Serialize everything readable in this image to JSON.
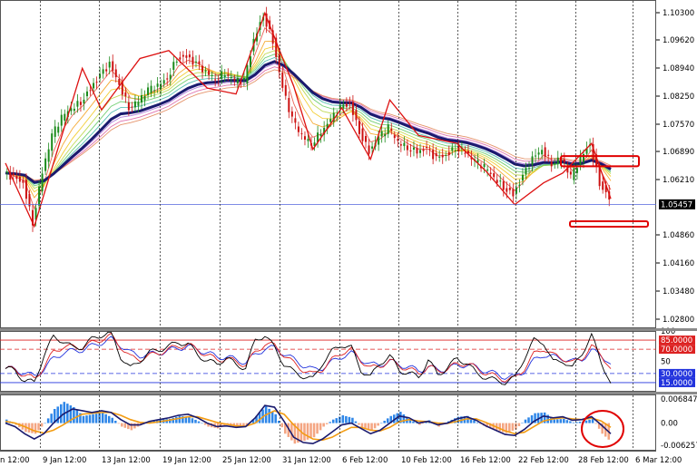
{
  "chart_data": {
    "type": "line",
    "x_labels": [
      "9 Jan 12:00",
      "13 Jan 12:00",
      "19 Jan 12:00",
      "25 Jan 12:00",
      "31 Jan 12:00",
      "6 Feb 12:00",
      "10 Feb 12:00",
      "16 Feb 12:00",
      "22 Feb 12:00",
      "28 Feb 12:00",
      "6 Mar 12:00"
    ],
    "x_label_first_partial": "n 12:00",
    "main": {
      "y_ticks": [
        "1.10300",
        "1.09620",
        "1.08940",
        "1.08250",
        "1.07570",
        "1.06890",
        "1.06210",
        "1.04860",
        "1.04160",
        "1.03480",
        "1.02800"
      ],
      "ylim": [
        1.0232,
        1.1063
      ],
      "current_price": "1.05457",
      "colors": {
        "candle_up": "#1a8a1a",
        "candle_down": "#cc1111",
        "zigzag": "#dd1111",
        "trend_ma": "#1a1a6e",
        "price_line": "#5566dd"
      },
      "close": [
        1.0625,
        1.0612,
        1.06,
        1.05,
        1.0628,
        1.072,
        1.0765,
        1.079,
        1.0805,
        1.0838,
        1.087,
        1.09,
        1.085,
        1.0792,
        1.0808,
        1.0835,
        1.0845,
        1.0865,
        1.0915,
        1.0918,
        1.09,
        1.088,
        1.0865,
        1.088,
        1.086,
        1.0858,
        1.096,
        1.1025,
        1.096,
        1.084,
        1.076,
        1.072,
        1.07,
        1.073,
        1.076,
        1.079,
        1.08,
        1.073,
        1.068,
        1.0715,
        1.074,
        1.0705,
        1.069,
        1.068,
        1.0685,
        1.066,
        1.067,
        1.069,
        1.068,
        1.0655,
        1.064,
        1.0615,
        1.059,
        1.057,
        1.0615,
        1.066,
        1.0685,
        1.065,
        1.0665,
        1.0615,
        1.066,
        1.07,
        1.06,
        1.056
      ],
      "zigzag": [
        [
          0,
          1.065
        ],
        [
          3,
          1.049
        ],
        [
          8,
          1.089
        ],
        [
          10,
          1.0785
        ],
        [
          14,
          1.0915
        ],
        [
          17,
          1.0935
        ],
        [
          21,
          1.084
        ],
        [
          24,
          1.0825
        ],
        [
          27,
          1.103
        ],
        [
          30,
          1.0845
        ],
        [
          32,
          1.0685
        ],
        [
          35,
          1.079
        ],
        [
          38,
          1.066
        ],
        [
          40,
          1.081
        ],
        [
          43,
          1.072
        ],
        [
          47,
          1.07
        ],
        [
          50,
          1.063
        ],
        [
          53,
          1.0545
        ],
        [
          56,
          1.06
        ],
        [
          58,
          1.0625
        ],
        [
          61,
          1.07
        ],
        [
          63,
          1.056
        ]
      ],
      "highlight_zones": [
        [
          1.0642,
          1.0668
        ],
        [
          1.0489,
          1.0503
        ]
      ]
    },
    "oscillator": {
      "y_ticks": [
        "100",
        "85.0000",
        "70.0000",
        "50",
        "30.0000",
        "15.0000"
      ],
      "levels": [
        85,
        70,
        30,
        15
      ],
      "ylim": [
        0,
        100
      ],
      "colors": {
        "line_black": "#000000",
        "line_red": "#dd2222",
        "line_blue": "#2233dd"
      },
      "values": [
        38,
        35,
        18,
        15,
        60,
        90,
        84,
        72,
        74,
        86,
        94,
        96,
        58,
        38,
        52,
        64,
        70,
        74,
        82,
        78,
        62,
        50,
        46,
        56,
        44,
        40,
        84,
        94,
        72,
        46,
        32,
        26,
        20,
        48,
        66,
        78,
        72,
        36,
        24,
        48,
        58,
        36,
        30,
        24,
        52,
        28,
        40,
        54,
        48,
        30,
        24,
        18,
        16,
        22,
        56,
        84,
        82,
        48,
        52,
        38,
        64,
        92,
        50,
        14
      ]
    },
    "macd": {
      "y_ticks": [
        "0.0068477",
        "0.00",
        "-0.006257"
      ],
      "ylim": [
        -0.0078,
        0.0081
      ],
      "colors": {
        "hist_pos": "#2e86e8",
        "hist_neg": "#f4a582",
        "line_dark": "#1a1a6e",
        "line_orange": "#f39c12"
      },
      "hist": [
        0.001,
        -0.0005,
        -0.0025,
        -0.003,
        0.0,
        0.004,
        0.006,
        0.0045,
        0.002,
        0.0025,
        0.003,
        0.0015,
        -0.001,
        -0.002,
        -0.0005,
        0.0005,
        0.001,
        0.0012,
        0.002,
        0.0018,
        0.0005,
        -0.001,
        -0.0015,
        -0.0005,
        -0.001,
        -0.0008,
        0.002,
        0.0048,
        0.0025,
        -0.003,
        -0.0058,
        -0.005,
        -0.004,
        -0.001,
        0.001,
        0.0022,
        0.0015,
        -0.0015,
        -0.0022,
        0.0,
        0.002,
        0.0032,
        0.001,
        -0.0005,
        0.0008,
        -0.001,
        0.0005,
        0.0018,
        0.002,
        0.0002,
        -0.0012,
        -0.002,
        -0.0028,
        -0.0018,
        0.001,
        0.0028,
        0.003,
        0.001,
        0.0012,
        0.0002,
        0.0005,
        0.0012,
        -0.003,
        -0.0055
      ],
      "macd_line": [
        0.0,
        -0.001,
        -0.003,
        -0.0045,
        -0.003,
        0.0,
        0.0025,
        0.004,
        0.0035,
        0.003,
        0.0035,
        0.003,
        0.001,
        -0.0005,
        -0.0005,
        0.0005,
        0.001,
        0.0015,
        0.0022,
        0.0025,
        0.0015,
        0.0,
        -0.001,
        -0.0008,
        -0.0012,
        -0.001,
        0.0015,
        0.005,
        0.0045,
        0.0005,
        -0.004,
        -0.0055,
        -0.0058,
        -0.0045,
        -0.0025,
        -0.0005,
        0.0,
        -0.0015,
        -0.003,
        -0.002,
        0.0,
        0.002,
        0.0015,
        0.0,
        0.0005,
        -0.0005,
        0.0,
        0.0012,
        0.0018,
        0.0008,
        -0.0008,
        -0.002,
        -0.0032,
        -0.0035,
        -0.0018,
        0.0005,
        0.002,
        0.0015,
        0.0018,
        0.0008,
        0.001,
        0.0018,
        -0.0005,
        -0.003
      ],
      "signal_line": [
        0.0005,
        0.0,
        -0.001,
        -0.0022,
        -0.0028,
        -0.002,
        -0.0005,
        0.0012,
        0.0025,
        0.0028,
        0.003,
        0.003,
        0.0022,
        0.001,
        0.0002,
        0.0,
        0.0004,
        0.0008,
        0.0013,
        0.0018,
        0.0018,
        0.001,
        0.0002,
        -0.0003,
        -0.0008,
        -0.0009,
        0.0,
        0.0022,
        0.0035,
        0.0025,
        -0.0005,
        -0.003,
        -0.0045,
        -0.0048,
        -0.004,
        -0.0025,
        -0.0012,
        -0.0012,
        -0.002,
        -0.0022,
        -0.0012,
        0.0004,
        0.001,
        0.0006,
        0.0004,
        0.0,
        -0.0001,
        0.0005,
        0.0012,
        0.0012,
        0.0002,
        -0.001,
        -0.0022,
        -0.003,
        -0.0026,
        -0.001,
        0.0006,
        0.0012,
        0.0015,
        0.0012,
        0.001,
        0.0014,
        0.0006,
        -0.0012
      ]
    }
  }
}
